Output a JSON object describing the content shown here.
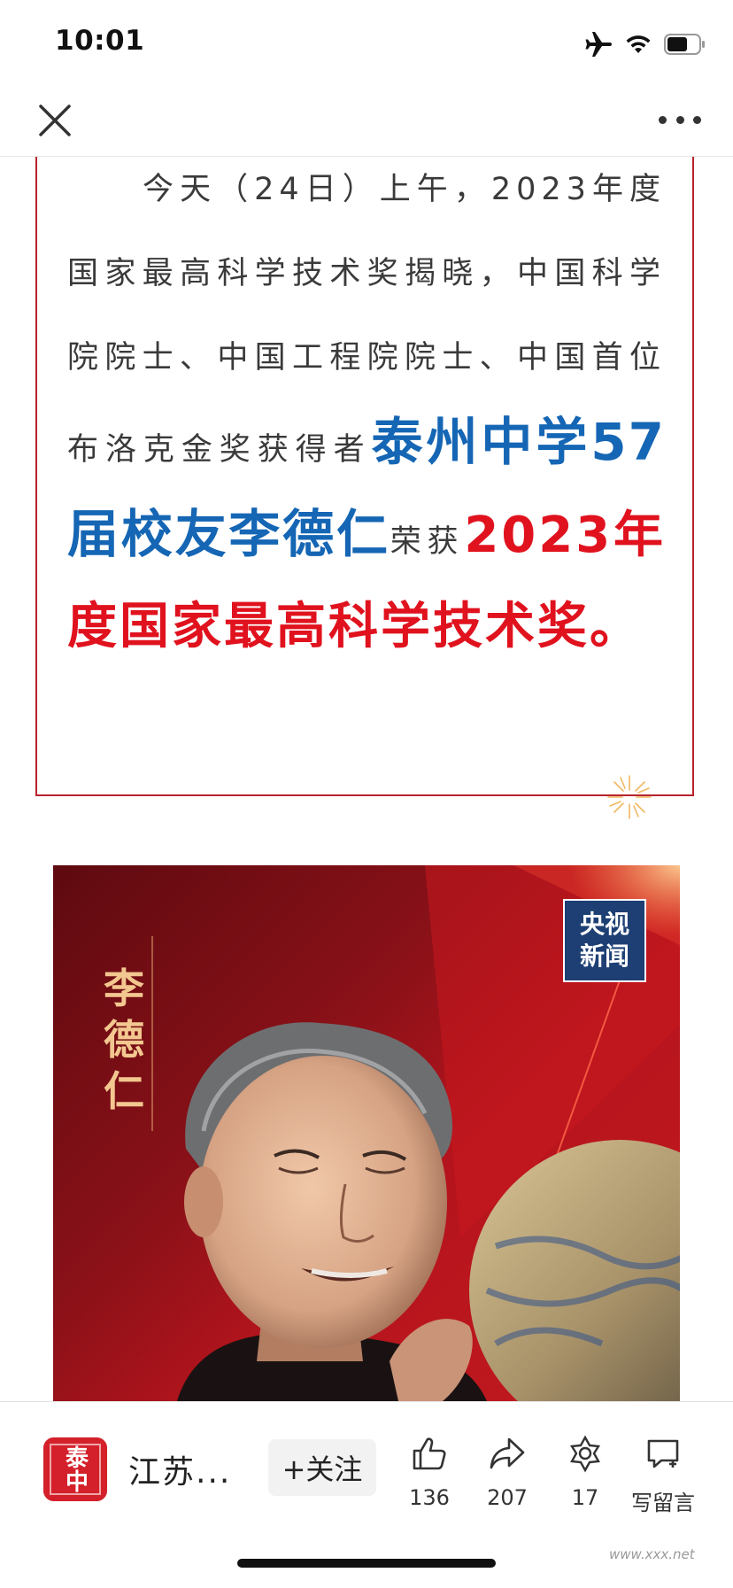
{
  "status_bar": {
    "time": "10:01"
  },
  "article": {
    "intro": "今天（24日）上午，2023年度国家最高科学技术奖揭晓，中国科学院院士、中国工程院院士、中国首位布洛克金奖获得者",
    "highlight_blue": "泰州中学57届校友李德仁",
    "after_blue": "荣获",
    "highlight_red": "2023年度国家最高科学技术奖。",
    "colors": {
      "blue": "#1566b4",
      "red": "#e0121e",
      "border": "#b8232d"
    }
  },
  "photo": {
    "name_vertical": [
      "李",
      "德",
      "仁"
    ],
    "logo_line1": "央视",
    "logo_line2": "新闻"
  },
  "bottom_bar": {
    "avatar_text": "泰中",
    "account_name": "江苏...",
    "follow_label": "+关注",
    "like_count": "136",
    "share_count": "207",
    "wow_count": "17",
    "comment_label": "写留言"
  },
  "watermark": "www.xxx.net"
}
